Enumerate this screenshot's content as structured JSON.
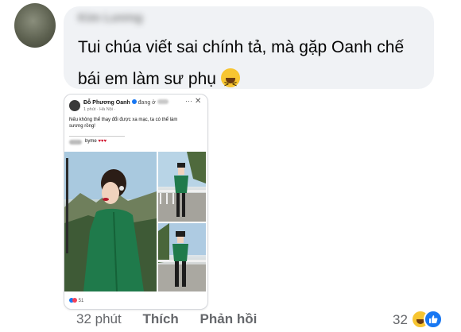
{
  "comment": {
    "author_name": "Kim Lương",
    "text": "Tui chúa viết sai chính tả, mà gặp Oanh chế bái em làm sư phụ",
    "emoji": "laughing-emoji"
  },
  "shared_post": {
    "author": "Đỗ Phương Oanh",
    "status": "đang ở",
    "meta": "1 phút · Hà Nội ·",
    "caption": "Nếu không thể thay đổi được xa mạc, ta có thể làm sương rồng!",
    "mention": "byme",
    "hearts": "♥♥♥",
    "reaction_count": "51"
  },
  "actions": {
    "time": "32 phút",
    "like": "Thích",
    "reply": "Phản hồi"
  },
  "reactions": {
    "count": "32",
    "types": [
      "haha-reaction-icon",
      "like-reaction-icon"
    ]
  },
  "colors": {
    "bubble": "#f0f2f5",
    "meta_text": "#65676b",
    "like_blue": "#1877f2",
    "haha_yellow": "#f7c531"
  }
}
